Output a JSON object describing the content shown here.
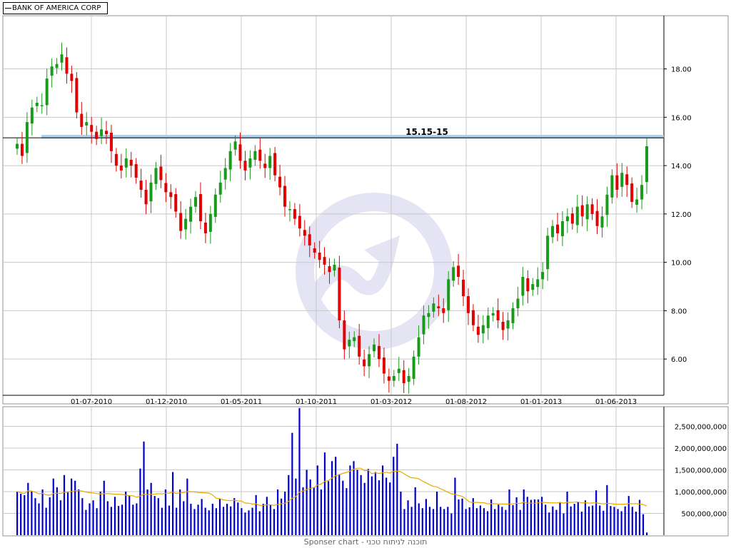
{
  "legend": {
    "label": "BANK OF AMERICA CORP"
  },
  "annotation": {
    "label": "15.15-15",
    "level": 15.15
  },
  "footer": {
    "text": "Sponser chart - תוכנה לניתוח טכני"
  },
  "colors": {
    "up": "#1a9a1a",
    "down": "#e00000",
    "volume": "#0000cc",
    "ma": "#e8a800",
    "band": "#a8cff0",
    "grid": "#c8c8c8"
  },
  "chart_data": [
    {
      "type": "candlestick",
      "title": "BANK OF AMERICA CORP",
      "x_ticks": [
        "01-07-2010",
        "01-12-2010",
        "01-05-2011",
        "01-10-2011",
        "01-03-2012",
        "01-08-2012",
        "01-01-2013",
        "01-06-2013"
      ],
      "y_ticks": [
        "6.00",
        "8.00",
        "10.00",
        "12.00",
        "14.00",
        "16.00",
        "18.00"
      ],
      "ylim": [
        4.5,
        20.2
      ],
      "grid": true,
      "horizontal_line": 15.15,
      "close": [
        14.9,
        14.4,
        15.8,
        16.4,
        16.6,
        16.5,
        17.6,
        18.1,
        18.2,
        18.6,
        17.8,
        17.5,
        16.2,
        15.6,
        15.8,
        15.4,
        15.1,
        15.5,
        15.3,
        14.6,
        14.0,
        13.8,
        14.3,
        14.0,
        13.5,
        13.0,
        12.4,
        13.3,
        13.9,
        13.4,
        12.9,
        12.7,
        12.1,
        11.3,
        11.8,
        12.3,
        12.7,
        11.7,
        11.2,
        12.0,
        12.8,
        13.3,
        13.9,
        14.6,
        15.0,
        14.2,
        13.8,
        14.3,
        14.6,
        14.2,
        13.9,
        14.4,
        13.6,
        13.1,
        12.3,
        12.2,
        11.8,
        11.4,
        11.1,
        10.7,
        10.4,
        10.1,
        9.9,
        9.6,
        9.9,
        7.6,
        6.4,
        6.8,
        6.9,
        6.1,
        5.7,
        6.2,
        6.6,
        6.0,
        5.4,
        5.1,
        5.3,
        5.6,
        5.0,
        5.3,
        6.1,
        6.9,
        7.8,
        7.9,
        8.3,
        8.1,
        7.9,
        9.3,
        9.8,
        9.4,
        8.6,
        7.9,
        7.4,
        7.0,
        7.4,
        7.8,
        7.9,
        7.6,
        7.2,
        7.6,
        8.1,
        8.5,
        9.4,
        8.8,
        9.1,
        9.3,
        9.6,
        11.1,
        11.5,
        11.2,
        11.7,
        11.9,
        11.6,
        12.3,
        11.9,
        12.4,
        12.0,
        11.5,
        11.9,
        12.8,
        13.6,
        13.0,
        13.7,
        13.2,
        12.5,
        12.6,
        13.2,
        14.8
      ],
      "volume_ylim": [
        0,
        2950000000
      ],
      "volume_ticks": [
        "500,000,000",
        "1,000,000,000",
        "1,500,000,000",
        "2,000,000,000",
        "2,500,000,000"
      ],
      "volume": [
        1000000000,
        950000000,
        920000000,
        1200000000,
        1000000000,
        850000000,
        730000000,
        1050000000,
        630000000,
        870000000,
        1300000000,
        1100000000,
        800000000,
        1380000000,
        1000000000,
        1300000000,
        1250000000,
        1050000000,
        850000000,
        580000000,
        730000000,
        800000000,
        620000000,
        1000000000,
        1250000000,
        780000000,
        650000000,
        880000000,
        670000000,
        700000000,
        1000000000,
        900000000,
        700000000,
        730000000,
        1530000000,
        2150000000,
        1050000000,
        1200000000,
        900000000,
        850000000,
        630000000,
        1050000000,
        680000000,
        1450000000,
        630000000,
        1050000000,
        780000000,
        1300000000,
        720000000,
        600000000,
        700000000,
        830000000,
        630000000,
        570000000,
        720000000,
        620000000,
        830000000,
        650000000,
        720000000,
        660000000,
        850000000,
        750000000,
        620000000,
        520000000,
        570000000,
        630000000,
        920000000,
        550000000,
        720000000,
        880000000,
        700000000,
        600000000,
        1050000000,
        840000000,
        1000000000,
        1380000000,
        2350000000,
        1300000000,
        2920000000,
        1100000000,
        1500000000,
        1280000000,
        1100000000,
        1600000000,
        1050000000,
        1900000000,
        1240000000,
        1700000000,
        1800000000,
        1400000000,
        1250000000,
        1080000000,
        1600000000,
        1700000000,
        1500000000,
        1380000000,
        1200000000,
        1520000000,
        1350000000,
        1450000000,
        1260000000,
        1600000000,
        1320000000,
        1210000000,
        1800000000,
        2100000000,
        1000000000,
        600000000,
        800000000,
        650000000,
        1100000000,
        730000000,
        620000000,
        830000000,
        650000000,
        600000000,
        1000000000,
        650000000,
        600000000,
        650000000,
        500000000,
        1320000000,
        820000000,
        840000000,
        600000000,
        640000000,
        850000000,
        620000000,
        680000000,
        620000000,
        550000000,
        820000000,
        600000000,
        700000000,
        650000000,
        580000000,
        1050000000,
        690000000,
        870000000,
        580000000,
        1050000000,
        880000000,
        810000000,
        820000000,
        820000000,
        880000000,
        700000000,
        520000000,
        660000000,
        580000000,
        760000000,
        500000000,
        1000000000,
        660000000,
        720000000,
        760000000,
        540000000,
        800000000,
        660000000,
        680000000,
        1030000000,
        680000000,
        560000000,
        1150000000,
        670000000,
        650000000,
        600000000,
        550000000,
        660000000,
        900000000,
        650000000,
        540000000,
        810000000,
        480000000,
        60000000
      ]
    }
  ]
}
